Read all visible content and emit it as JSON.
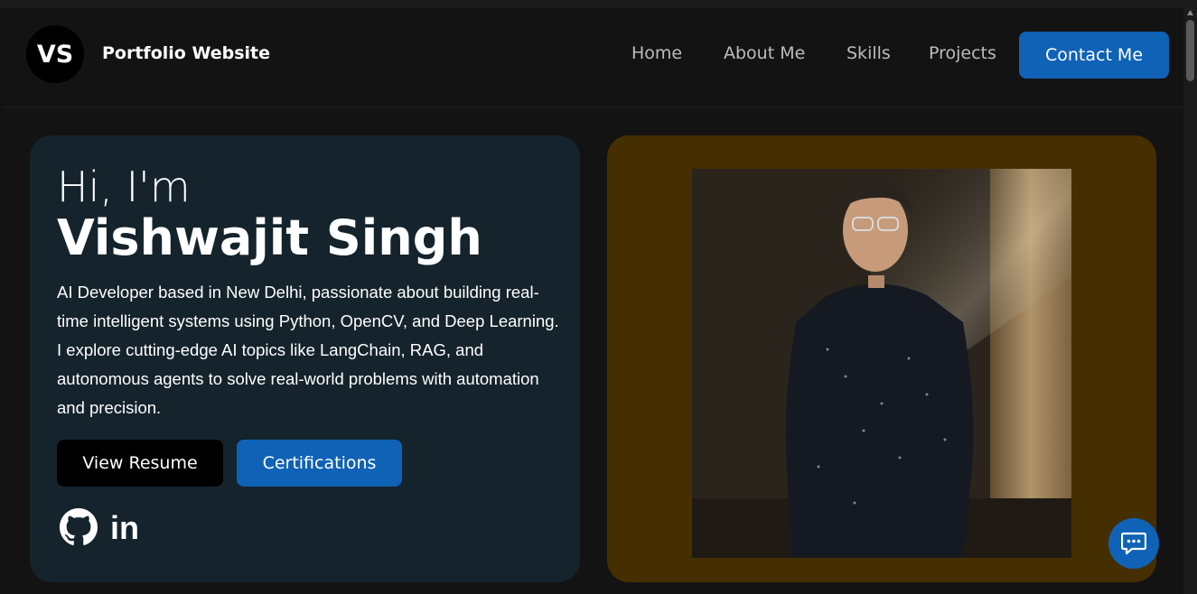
{
  "header": {
    "logo_text": "VS",
    "site_title": "Portfolio Website",
    "nav": [
      {
        "label": "Home"
      },
      {
        "label": "About Me"
      },
      {
        "label": "Skills"
      },
      {
        "label": "Projects"
      }
    ],
    "contact_label": "Contact Me"
  },
  "hero": {
    "greeting": "Hi, I'm",
    "name": "Vishwajit Singh",
    "bio": "AI Developer based in New Delhi, passionate about building real-time intelligent systems using Python, OpenCV, and Deep Learning. I explore cutting-edge AI topics like LangChain, RAG, and autonomous agents to solve real-world problems with automation and precision.",
    "resume_label": "View Resume",
    "certifications_label": "Certifications",
    "social": [
      {
        "icon": "github-icon"
      },
      {
        "icon": "linkedin-icon",
        "text": "in"
      }
    ]
  },
  "photo_card": {
    "background_color": "#452f00"
  },
  "chat": {
    "icon": "chat-bubble-icon"
  },
  "colors": {
    "accent": "#0f62b6",
    "hero_card": "#14232c",
    "page_bg": "#131313"
  }
}
